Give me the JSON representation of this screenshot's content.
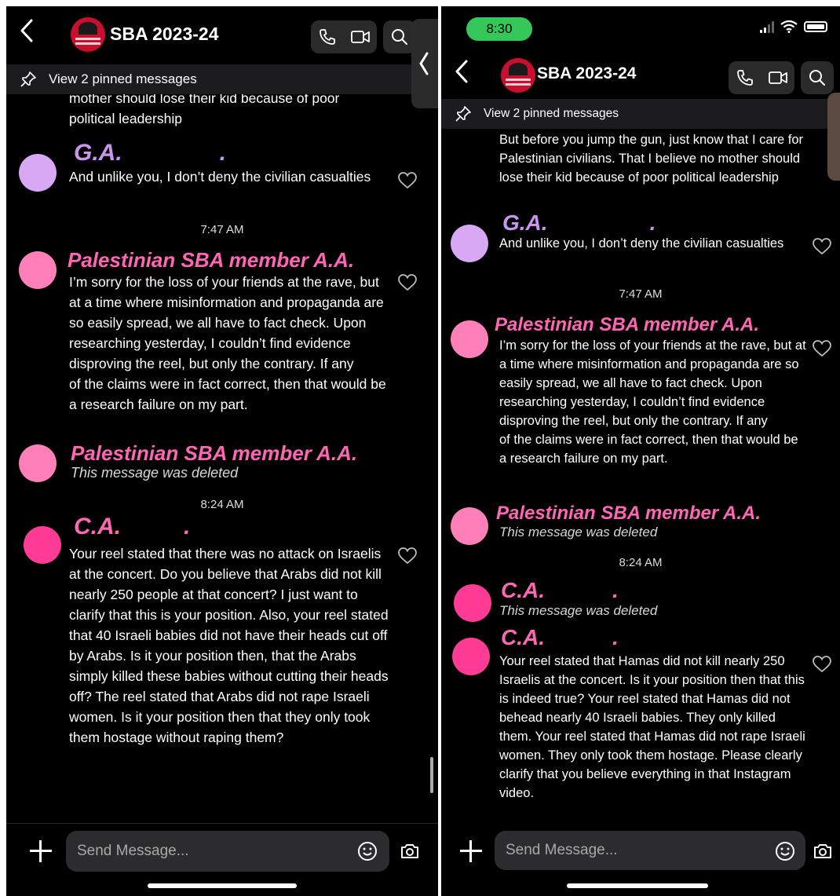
{
  "group": {
    "title": "SBA 2023-24"
  },
  "pinned_label": "View 2 pinned messages",
  "composer": {
    "placeholder": "Send Message..."
  },
  "colors": {
    "lavender": "#d8a8f5",
    "pink": "#ff7fb8",
    "pink_hot": "#ff3b96",
    "sender_lavender": "#c896f0",
    "sender_pink": "#ff66b3"
  },
  "left": {
    "top_fragment": "mother should lose their kid because of poor political leadership",
    "messages": [
      {
        "sender": "G.A.",
        "sender_suffix": ".",
        "text": "And unlike you, I don’t deny the civilian casualties"
      },
      {
        "timestamp": "7:47 AM"
      },
      {
        "sender": "Palestinian SBA member A.A.",
        "text": "I’m sorry for the loss of your friends at the rave, but at a time where misinformation and propaganda are so easily spread, we all have to fact check. Upon researching yesterday, I couldn’t find evidence disproving the reel, but only the contrary. If any",
        "text2": "of the claims were in fact correct, then that would be a research failure on my part."
      },
      {
        "sender": "Palestinian SBA member A.A.",
        "deleted": "This message was deleted"
      },
      {
        "timestamp": "8:24 AM"
      },
      {
        "sender": "C.A.",
        "sender_suffix": ".",
        "text": "Your reel stated that there was no attack on Israelis at the concert. Do you believe that Arabs did not kill nearly 250 people at that concert? I just want to clarify that this is your position. Also, your reel stated that 40 Israeli babies did not have their heads cut off by Arabs. Is it your position then, that the Arabs simply killed these babies without cutting their heads off? The reel stated that Arabs did not rape Israeli women. Is it your position then that they only took them hostage without raping them?"
      }
    ]
  },
  "right": {
    "status_time": "8:30",
    "top_fragment": "But before you jump the gun, just know that I care for Palestinian civilians. That I believe no mother should lose their kid because of poor political leadership",
    "messages": [
      {
        "sender": "G.A.",
        "sender_suffix": ".",
        "text": "And unlike you, I don’t deny the civilian casualties"
      },
      {
        "timestamp": "7:47 AM"
      },
      {
        "sender": "Palestinian SBA member A.A.",
        "text": "I’m sorry for the loss of your friends at the rave, but at a time where misinformation and propaganda are so easily spread, we all have to fact check. Upon researching yesterday, I couldn’t find evidence disproving the reel, but only the contrary. If any",
        "text2": "of the claims were in fact correct, then that would be a research failure on my part."
      },
      {
        "sender": "Palestinian SBA member A.A.",
        "deleted": "This message was deleted"
      },
      {
        "timestamp": "8:24 AM"
      },
      {
        "sender": "C.A.",
        "sender_suffix": ".",
        "deleted": "This message was deleted"
      },
      {
        "sender": "C.A.",
        "sender_suffix": ".",
        "text": "Your reel stated that Hamas did not kill nearly 250 Israelis at the concert. Is it your position then that this is indeed true? Your reel stated that Hamas did not behead nearly 40 Israeli babies. They only killed them. Your reel stated that Hamas did not rape Israeli women. They only took them hostage. Please clearly clarify that you believe everything in that Instagram video."
      }
    ]
  }
}
